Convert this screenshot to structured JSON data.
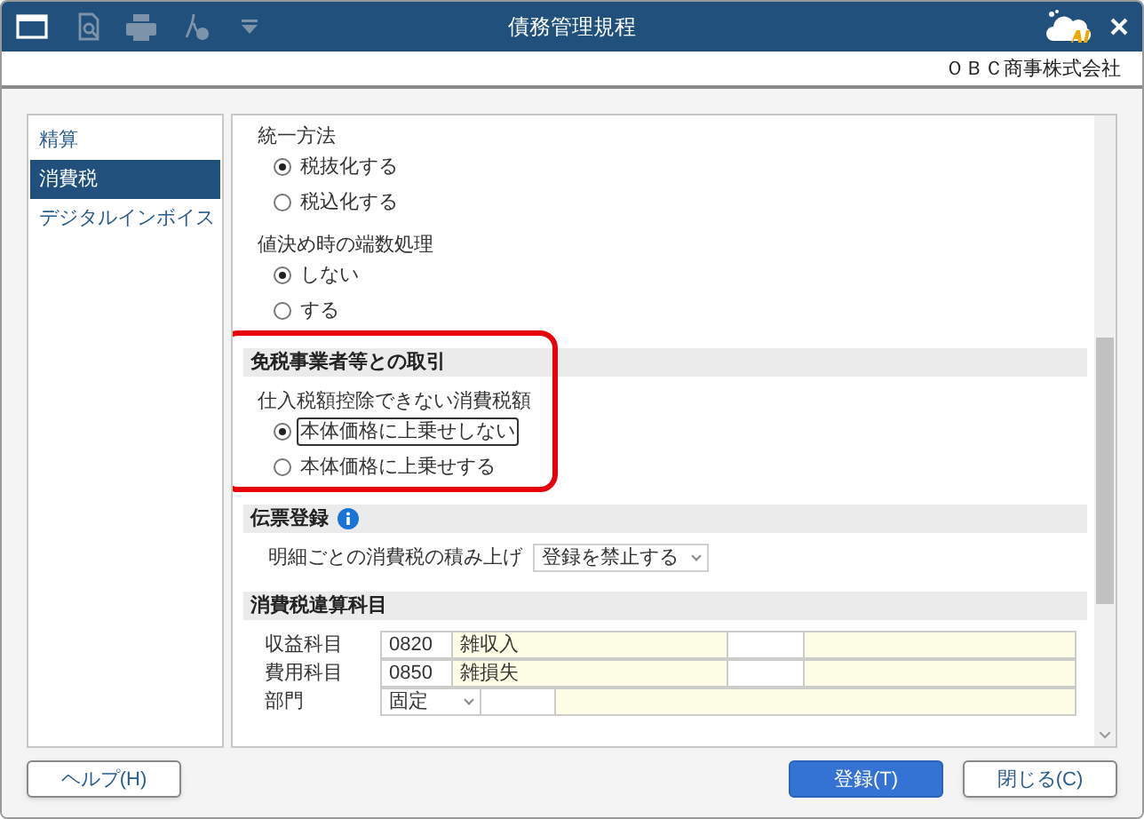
{
  "window": {
    "title": "債務管理規程",
    "company": "ＯＢＣ商事株式会社"
  },
  "sidebar": {
    "items": [
      {
        "label": "精算",
        "selected": false
      },
      {
        "label": "消費税",
        "selected": true
      },
      {
        "label": "デジタルインボイス",
        "selected": false
      }
    ]
  },
  "sections": [
    {
      "groups": [
        {
          "kind": "radio-group",
          "label": "統一方法",
          "options": [
            {
              "label": "税抜化する",
              "selected": true,
              "focused": false
            },
            {
              "label": "税込化する",
              "selected": false,
              "focused": false
            }
          ]
        },
        {
          "kind": "radio-group",
          "label": "値決め時の端数処理",
          "options": [
            {
              "label": "しない",
              "selected": true,
              "focused": false
            },
            {
              "label": "する",
              "selected": false,
              "focused": false
            }
          ]
        }
      ]
    },
    {
      "title": "免税事業者等との取引",
      "highlighted": true,
      "groups": [
        {
          "kind": "radio-group",
          "label": "仕入税額控除できない消費税額",
          "options": [
            {
              "label": "本体価格に上乗せしない",
              "selected": true,
              "focused": true
            },
            {
              "label": "本体価格に上乗せする",
              "selected": false,
              "focused": false
            }
          ]
        }
      ]
    },
    {
      "title": "伝票登録",
      "info": true,
      "groups": [
        {
          "kind": "select",
          "label": "明細ごとの消費税の積み上げ",
          "value": "登録を禁止する"
        }
      ]
    },
    {
      "title": "消費税違算科目",
      "groups": [
        {
          "kind": "accounts",
          "rows": [
            {
              "label": "収益科目",
              "code": "0820",
              "name": "雑収入"
            },
            {
              "label": "費用科目",
              "code": "0850",
              "name": "雑損失"
            }
          ],
          "department": {
            "label": "部門",
            "value": "固定"
          }
        }
      ]
    }
  ],
  "footer": {
    "help": "ヘルプ(H)",
    "buttons": [
      {
        "label": "登録(T)",
        "primary": true
      },
      {
        "label": "閉じる(C)",
        "primary": false
      }
    ]
  }
}
